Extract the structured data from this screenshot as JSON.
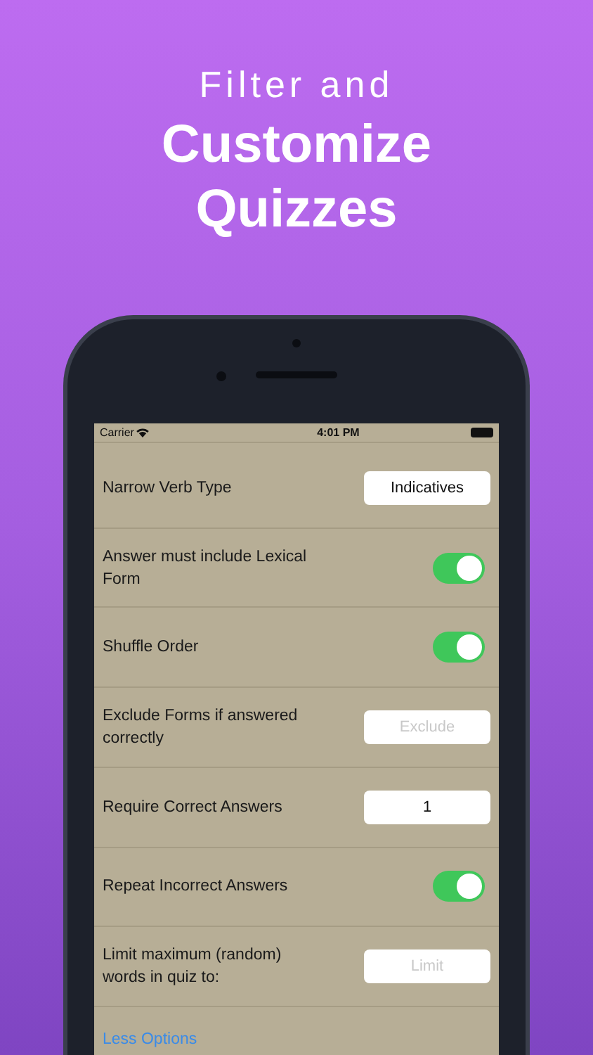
{
  "headline": {
    "subtitle": "Filter and",
    "title": "Customize Quizzes"
  },
  "status_bar": {
    "carrier": "Carrier",
    "time": "4:01 PM"
  },
  "settings": [
    {
      "kind": "field",
      "label": "Narrow Verb Type",
      "value": "Indicatives"
    },
    {
      "kind": "toggle",
      "label": "Answer must include Lexical Form",
      "on": true
    },
    {
      "kind": "toggle",
      "label": "Shuffle Order",
      "on": true
    },
    {
      "kind": "field",
      "label": "Exclude Forms if answered correctly",
      "placeholder": "Exclude"
    },
    {
      "kind": "field",
      "label": "Require Correct Answers",
      "value": "1"
    },
    {
      "kind": "toggle",
      "label": "Repeat Incorrect Answers",
      "on": true
    },
    {
      "kind": "field",
      "label": "Limit maximum (random) words in quiz to:",
      "placeholder": "Limit"
    }
  ],
  "less_options_link": "Less Options"
}
